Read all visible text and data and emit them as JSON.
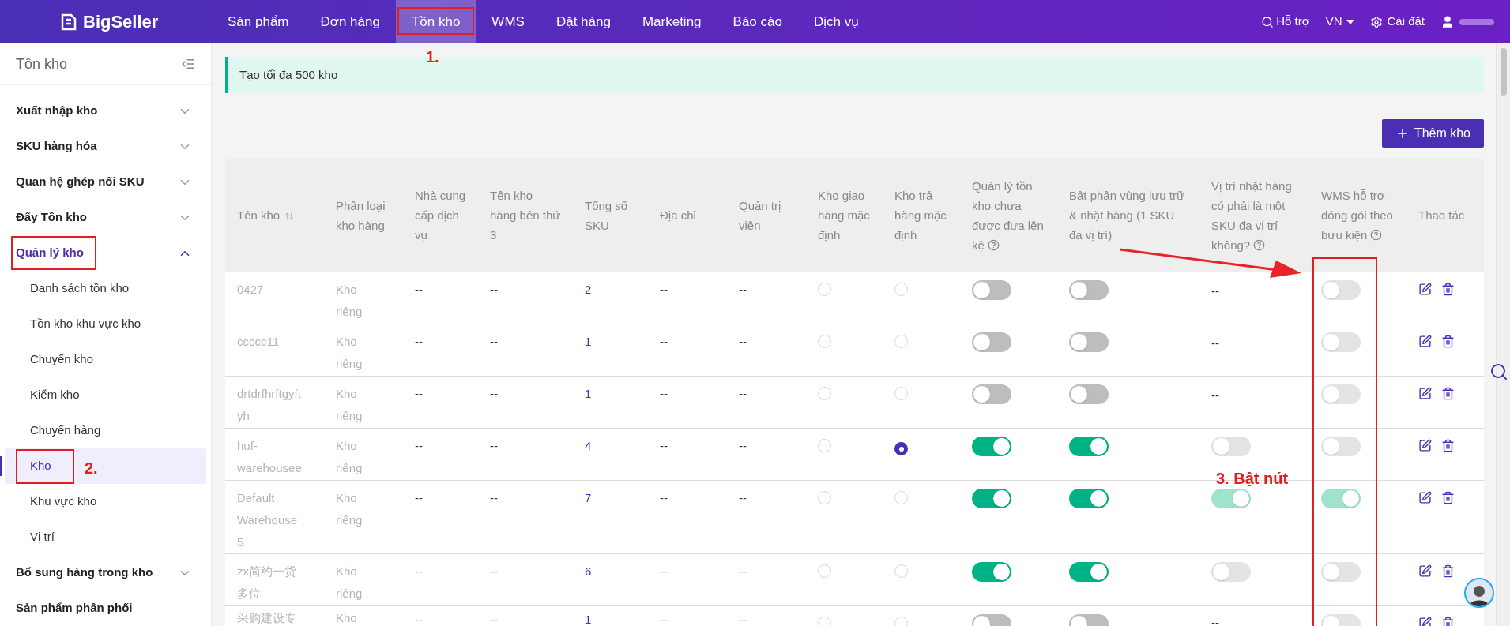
{
  "brand": "BigSeller",
  "nav": [
    {
      "label": "Sản phẩm",
      "selected": false
    },
    {
      "label": "Đơn hàng",
      "selected": false
    },
    {
      "label": "Tồn kho",
      "selected": true,
      "boxed": true,
      "annotation": "1."
    },
    {
      "label": "WMS",
      "selected": false
    },
    {
      "label": "Đặt hàng",
      "selected": false
    },
    {
      "label": "Marketing",
      "selected": false
    },
    {
      "label": "Báo cáo",
      "selected": false
    },
    {
      "label": "Dịch vụ",
      "selected": false
    }
  ],
  "header_right": {
    "help": "Hỗ trợ",
    "language": "VN",
    "settings": "Cài đặt"
  },
  "sidebar": {
    "title": "Tồn kho",
    "groups": [
      {
        "label": "Xuất nhập kho",
        "expanded": false,
        "has_caret": true,
        "selected": false,
        "boxed": false
      },
      {
        "label": "SKU hàng hóa",
        "expanded": false,
        "has_caret": true,
        "selected": false,
        "boxed": false
      },
      {
        "label": "Quan hệ ghép nối SKU",
        "expanded": false,
        "has_caret": true,
        "selected": false,
        "boxed": false
      },
      {
        "label": "Đẩy Tồn kho",
        "expanded": false,
        "has_caret": true,
        "selected": false,
        "boxed": false
      },
      {
        "label": "Quản lý kho",
        "expanded": true,
        "has_caret": true,
        "selected": true,
        "boxed": true,
        "children": [
          {
            "label": "Danh sách tồn kho",
            "selected": false
          },
          {
            "label": "Tồn kho khu vực kho",
            "selected": false
          },
          {
            "label": "Chuyển kho",
            "selected": false
          },
          {
            "label": "Kiểm kho",
            "selected": false
          },
          {
            "label": "Chuyển hàng",
            "selected": false
          },
          {
            "label": "Kho",
            "selected": true,
            "boxed": true,
            "annotation": "2."
          },
          {
            "label": "Khu vực kho",
            "selected": false
          },
          {
            "label": "Vị trí",
            "selected": false
          }
        ]
      },
      {
        "label": "Bổ sung hàng trong kho",
        "expanded": false,
        "has_caret": true,
        "selected": false,
        "boxed": false
      },
      {
        "label": "Sản phẩm phân phối",
        "expanded": false,
        "has_caret": false,
        "selected": false,
        "boxed": false
      }
    ]
  },
  "notice": "Tạo tối đa 500 kho",
  "add_button": "Thêm kho",
  "table": {
    "columns": [
      {
        "label": "Tên kho",
        "sortable": true,
        "help": false
      },
      {
        "label": "Phân loại kho hàng",
        "sortable": false,
        "help": false
      },
      {
        "label": "Nhà cung cấp dịch vụ",
        "sortable": false,
        "help": false
      },
      {
        "label": "Tên kho hàng bên thứ 3",
        "sortable": false,
        "help": false
      },
      {
        "label": "Tổng số SKU",
        "sortable": false,
        "help": false
      },
      {
        "label": "Địa chỉ",
        "sortable": false,
        "help": false
      },
      {
        "label": "Quản trị viên",
        "sortable": false,
        "help": false
      },
      {
        "label": "Kho giao hàng mặc định",
        "sortable": false,
        "help": false
      },
      {
        "label": "Kho trả hàng mặc định",
        "sortable": false,
        "help": false
      },
      {
        "label": "Quản lý tồn kho chưa được đưa lên kệ",
        "sortable": false,
        "help": true
      },
      {
        "label": "Bật phân vùng lưu trữ & nhặt hàng (1 SKU đa vị trí)",
        "sortable": false,
        "help": false
      },
      {
        "label": "Vị trí nhặt hàng có phải là một SKU đa vị trí không?",
        "sortable": false,
        "help": true
      },
      {
        "label": "WMS hỗ trợ đóng gói theo bưu kiện",
        "sortable": false,
        "help": true,
        "boxed": true,
        "annotation": "3. Bật nút"
      },
      {
        "label": "Thao tác",
        "sortable": false,
        "help": false
      }
    ],
    "rows": [
      {
        "name": "0427",
        "type": "Kho riêng",
        "provider": "--",
        "third_party": "--",
        "sku": "2",
        "address": "--",
        "admin": "--",
        "default_ship": false,
        "default_return": false,
        "unshelved": {
          "on": false,
          "disabled": false
        },
        "zoning": {
          "on": false,
          "disabled": false
        },
        "multi_location": {
          "kind": "text",
          "text": "--"
        },
        "wms_parcel": {
          "on": false,
          "disabled": true
        }
      },
      {
        "name": "ccccc11",
        "type": "Kho riêng",
        "provider": "--",
        "third_party": "--",
        "sku": "1",
        "address": "--",
        "admin": "--",
        "default_ship": false,
        "default_return": false,
        "unshelved": {
          "on": false,
          "disabled": false
        },
        "zoning": {
          "on": false,
          "disabled": false
        },
        "multi_location": {
          "kind": "text",
          "text": "--"
        },
        "wms_parcel": {
          "on": false,
          "disabled": true
        }
      },
      {
        "name": "drtdrfhrftgyftyh",
        "type": "Kho riêng",
        "provider": "--",
        "third_party": "--",
        "sku": "1",
        "address": "--",
        "admin": "--",
        "default_ship": false,
        "default_return": false,
        "unshelved": {
          "on": false,
          "disabled": false
        },
        "zoning": {
          "on": false,
          "disabled": false
        },
        "multi_location": {
          "kind": "text",
          "text": "--"
        },
        "wms_parcel": {
          "on": false,
          "disabled": true
        }
      },
      {
        "name": "huf-warehousee",
        "type": "Kho riêng",
        "provider": "--",
        "third_party": "--",
        "sku": "4",
        "address": "--",
        "admin": "--",
        "default_ship": false,
        "default_return": true,
        "unshelved": {
          "on": true,
          "disabled": false
        },
        "zoning": {
          "on": true,
          "disabled": false
        },
        "multi_location": {
          "kind": "switch",
          "on": false,
          "disabled": true
        },
        "wms_parcel": {
          "on": false,
          "disabled": true
        }
      },
      {
        "name": "Default Warehouse 5",
        "type": "Kho riêng",
        "provider": "--",
        "third_party": "--",
        "sku": "7",
        "address": "--",
        "admin": "--",
        "default_ship": false,
        "default_return": false,
        "unshelved": {
          "on": true,
          "disabled": false
        },
        "zoning": {
          "on": true,
          "disabled": false
        },
        "multi_location": {
          "kind": "switch",
          "on": true,
          "disabled": true
        },
        "wms_parcel": {
          "on": true,
          "disabled": true
        }
      },
      {
        "name": "zx简约一货多位",
        "type": "Kho riêng",
        "provider": "--",
        "third_party": "--",
        "sku": "6",
        "address": "--",
        "admin": "--",
        "default_ship": false,
        "default_return": false,
        "unshelved": {
          "on": true,
          "disabled": false
        },
        "zoning": {
          "on": true,
          "disabled": false
        },
        "multi_location": {
          "kind": "switch",
          "on": false,
          "disabled": true
        },
        "wms_parcel": {
          "on": false,
          "disabled": true
        }
      },
      {
        "name": "采购建设专",
        "type": "Kho",
        "provider": "--",
        "third_party": "--",
        "sku": "1",
        "address": "--",
        "admin": "--",
        "default_ship": false,
        "default_return": false,
        "unshelved": {
          "on": false,
          "disabled": false
        },
        "zoning": {
          "on": false,
          "disabled": false
        },
        "multi_location": {
          "kind": "text",
          "text": "--"
        },
        "wms_parcel": {
          "on": false,
          "disabled": true
        }
      }
    ]
  }
}
